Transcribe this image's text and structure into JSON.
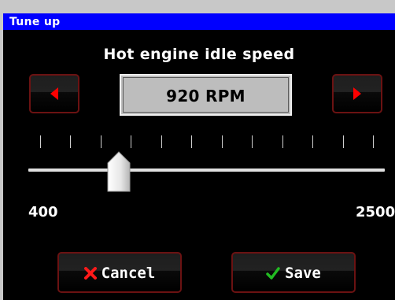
{
  "window": {
    "title": "Tune up"
  },
  "screen": {
    "heading": "Hot engine idle speed"
  },
  "value_display": {
    "text": "920 RPM"
  },
  "slider": {
    "min_label": "400",
    "max_label": "2500",
    "min": 400,
    "max": 2500,
    "value": 920,
    "tick_count": 12
  },
  "buttons": {
    "decrease": "left-arrow-icon",
    "increase": "right-arrow-icon",
    "cancel_label": "Cancel",
    "cancel_icon": "x-icon",
    "save_label": "Save",
    "save_icon": "checkmark-icon"
  },
  "colors": {
    "titlebar": "#0000ff",
    "background": "#000000",
    "button_border": "#6b1212",
    "arrow": "#ff0000",
    "cancel_icon": "#ff1a1a",
    "save_icon": "#22bb22",
    "value_box": "#bdbdbd"
  }
}
